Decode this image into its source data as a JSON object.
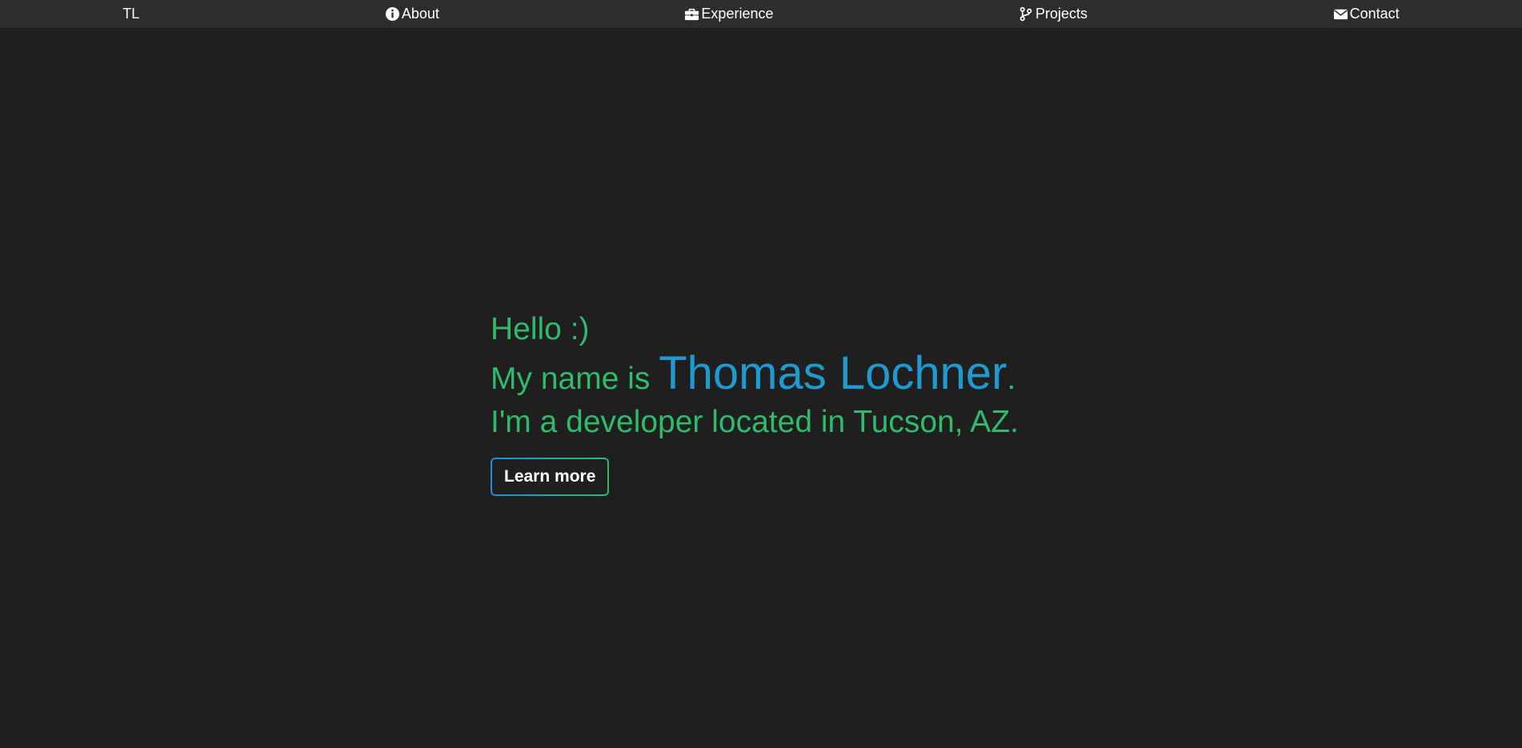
{
  "nav": {
    "brand": "TL",
    "items": [
      {
        "label": "About",
        "icon": "info-circle-icon"
      },
      {
        "label": "Experience",
        "icon": "briefcase-icon"
      },
      {
        "label": "Projects",
        "icon": "code-branch-icon"
      },
      {
        "label": "Contact",
        "icon": "envelope-icon"
      }
    ]
  },
  "hero": {
    "greeting": "Hello :)",
    "name_prefix": "My name is ",
    "name": "Thomas Lochner",
    "name_suffix": ".",
    "tagline": "I'm a developer located in Tucson, AZ.",
    "cta_label": "Learn more"
  },
  "colors": {
    "background": "#1f1f1f",
    "navbar": "#2d2d2d",
    "green": "#2fbb6a",
    "blue": "#1f9ad1"
  }
}
